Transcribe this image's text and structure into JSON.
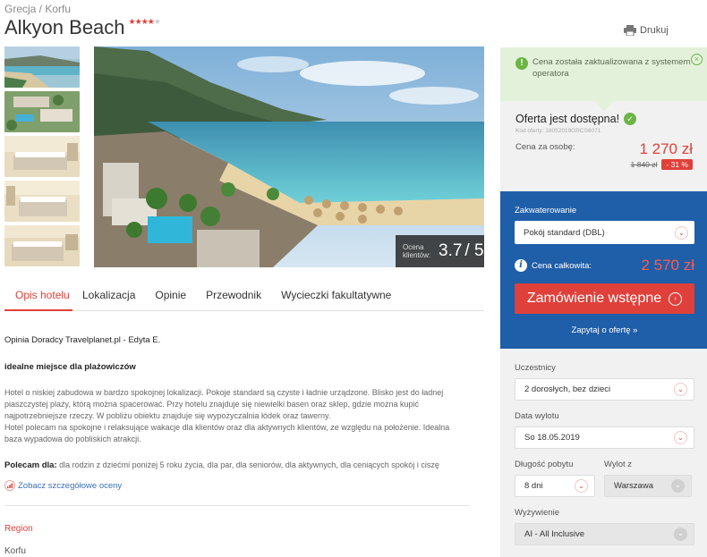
{
  "breadcrumb": [
    "Grecja",
    "Korfu"
  ],
  "breadcrumb_sep": " / ",
  "hotel": {
    "name": "Alkyon Beach",
    "stars_filled": 4,
    "stars_total": 5
  },
  "print_label": "Drukuj",
  "rating": {
    "label": "Ocena klientów:",
    "value": "3.7",
    "max": "/ 5"
  },
  "tabs": [
    "Opis hotelu",
    "Lokalizacja",
    "Opinie",
    "Przewodnik",
    "Wycieczki fakultatywne"
  ],
  "content": {
    "advisor": "Opinia Doradcy Travelplanet.pl - Edyta E.",
    "headline": "idealne miejsce dla plażowiczów",
    "description_lines": [
      "Hotel o niskiej zabudowa w bardzo spokojnej lokalizacji. Pokoje standard są czyste i ładnie urządzone. Blisko jest do ładnej",
      "piaszczystej plaży, którą można spacerować. Przy hotelu znajduje się niewielki basen oraz sklep, gdzie można kupić",
      "najpotrzebniejsze rzeczy. W pobliżu obiektu znajduje się wypożyczalnia łódek oraz tawerny.",
      "Hotel polecam na spokojne i relaksujące wakacje dla klientów oraz dla aktywnych klientów, ze względu na położenie. Idealna",
      "baza wypadowa do pobliskich atrakcji."
    ],
    "recommend_label": "Polecam dla:",
    "recommend_text": " dla rodzin z dziećmi poniżej 5 roku życia, dla par, dla seniorów, dla aktywnych, dla ceniących spokój i ciszę",
    "details_link": "Zobacz szczegółowe oceny",
    "region_heading": "Region",
    "region_value": "Korfu"
  },
  "alert": {
    "text": "Cena została zaktualizowana z systemem operatora"
  },
  "offer": {
    "title": "Oferta jest dostępna!",
    "code": "Kod oferty: 18052019GRCS6071",
    "price_label": "Cena za osobę:",
    "price": "1 270 zł",
    "old_price": "1 840 zł",
    "discount": "- 31 %"
  },
  "booking": {
    "accommodation_label": "Zakwaterowanie",
    "accommodation_value": "Pokój standard (DBL)",
    "total_label": "Cena całkowita:",
    "total_price": "2 570 zł",
    "order_button": "Zamówienie wstępne",
    "ask_link": "Zapytaj o ofertę »"
  },
  "params": {
    "participants_label": "Uczestnicy",
    "participants_value": "2 dorosłych, bez dzieci",
    "departure_date_label": "Data wylotu",
    "departure_date_value": "So 18.05.2019",
    "duration_label": "Długość pobytu",
    "duration_value": "8 dni",
    "from_label": "Wylot z",
    "from_value": "Warszawa",
    "board_label": "Wyżywienie",
    "board_value": "AI - All Inclusive"
  },
  "colors": {
    "accent": "#e0403a",
    "booking_bg": "#1f5ea8",
    "alert_bg": "#e4f1da",
    "success": "#6bb544"
  }
}
